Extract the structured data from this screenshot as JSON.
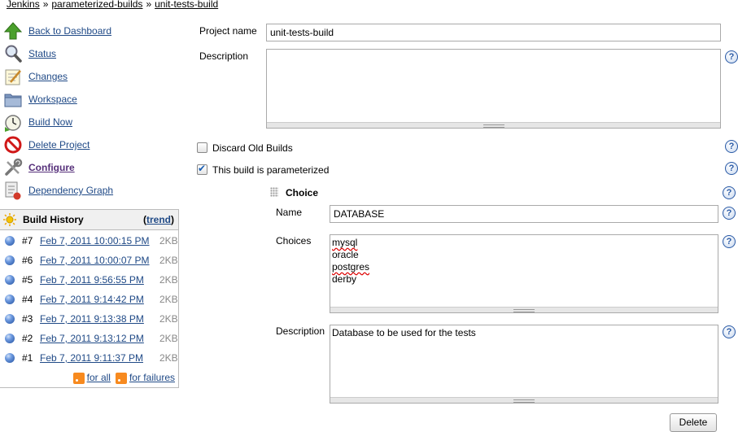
{
  "breadcrumb": {
    "items": [
      "Jenkins",
      "parameterized-builds",
      "unit-tests-build"
    ],
    "separator": "»"
  },
  "sidebar": {
    "items": [
      {
        "label": "Back to Dashboard",
        "icon": "up-arrow-icon"
      },
      {
        "label": "Status",
        "icon": "magnifier-icon"
      },
      {
        "label": "Changes",
        "icon": "notepad-icon"
      },
      {
        "label": "Workspace",
        "icon": "folder-icon"
      },
      {
        "label": "Build Now",
        "icon": "clock-icon"
      },
      {
        "label": "Delete Project",
        "icon": "no-entry-icon"
      },
      {
        "label": "Configure",
        "icon": "wrench-icon"
      },
      {
        "label": "Dependency Graph",
        "icon": "graph-icon"
      }
    ]
  },
  "build_history": {
    "title": "Build History",
    "trend_label": "trend",
    "builds": [
      {
        "number": "#7",
        "date": "Feb 7, 2011 10:00:15 PM",
        "size": "2KB"
      },
      {
        "number": "#6",
        "date": "Feb 7, 2011 10:00:07 PM",
        "size": "2KB"
      },
      {
        "number": "#5",
        "date": "Feb 7, 2011 9:56:55 PM",
        "size": "2KB"
      },
      {
        "number": "#4",
        "date": "Feb 7, 2011 9:14:42 PM",
        "size": "2KB"
      },
      {
        "number": "#3",
        "date": "Feb 7, 2011 9:13:38 PM",
        "size": "2KB"
      },
      {
        "number": "#2",
        "date": "Feb 7, 2011 9:13:12 PM",
        "size": "2KB"
      },
      {
        "number": "#1",
        "date": "Feb 7, 2011 9:11:37 PM",
        "size": "2KB"
      }
    ],
    "feed_all": "for all",
    "feed_failures": "for failures"
  },
  "form": {
    "project_name_label": "Project name",
    "project_name_value": "unit-tests-build",
    "description_label": "Description",
    "description_value": "",
    "discard_label": "Discard Old Builds",
    "discard_checked": false,
    "parameterized_label": "This build is parameterized",
    "parameterized_checked": true,
    "help_glyph": "?",
    "parameter": {
      "type_label": "Choice",
      "name_label": "Name",
      "name_value": "DATABASE",
      "choices_label": "Choices",
      "choices": [
        "mysql",
        "oracle",
        "postgres",
        "derby"
      ],
      "description_label": "Description",
      "description_value": "Database to be used for the tests",
      "delete_label": "Delete"
    }
  },
  "colors": {
    "link": "#204a87",
    "visited_link": "#56307a",
    "help_blue": "#2a5aa6"
  }
}
